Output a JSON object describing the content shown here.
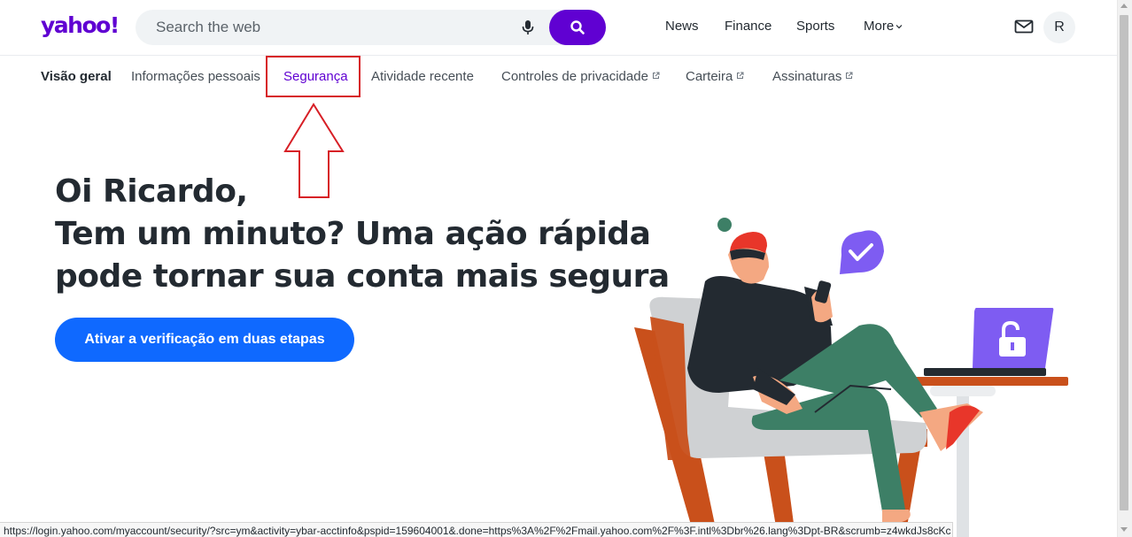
{
  "header": {
    "logo": "yahoo!",
    "search_placeholder": "Search the web",
    "nav": {
      "news": "News",
      "finance": "Finance",
      "sports": "Sports",
      "more": "More"
    },
    "avatar_initial": "R"
  },
  "tabs": [
    {
      "label": "Visão geral",
      "external": false
    },
    {
      "label": "Informações pessoais",
      "external": false
    },
    {
      "label": "Segurança",
      "external": false
    },
    {
      "label": "Atividade recente",
      "external": false
    },
    {
      "label": "Controles de privacidade",
      "external": true
    },
    {
      "label": "Carteira",
      "external": true
    },
    {
      "label": "Assinaturas",
      "external": true
    }
  ],
  "hero": {
    "line1": "Oi Ricardo,",
    "line2": "Tem um minuto? Uma ação rápida",
    "line3": "pode tornar sua conta mais segura",
    "cta": "Ativar a verificação em duas etapas"
  },
  "status_url": "https://login.yahoo.com/myaccount/security/?src=ym&activity=ybar-acctinfo&pspid=159604001&.done=https%3A%2F%2Fmail.yahoo.com%2F%3F.intl%3Dbr%26.lang%3Dpt-BR&scrumb=z4wkdJs8cKc",
  "colors": {
    "brand": "#6001d2",
    "cta": "#0f69ff",
    "annotation": "#d71f26"
  },
  "icons": [
    "mic-icon",
    "search-icon",
    "chevron-down-icon",
    "mail-icon",
    "external-link-icon",
    "checkmark-icon",
    "unlock-icon"
  ]
}
